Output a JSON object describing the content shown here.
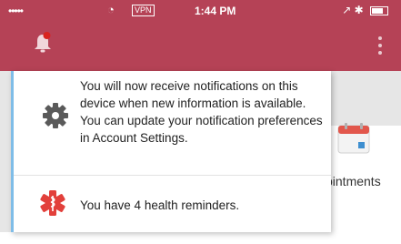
{
  "status_bar": {
    "signal": "•••••",
    "vpn": "VPN",
    "time": "1:44 PM",
    "icons": [
      "wifi-icon",
      "location-icon",
      "bluetooth-icon",
      "battery-icon"
    ]
  },
  "toolbar": {
    "notification_icon": "bell-icon",
    "unread_indicator": true,
    "menu_icon": "kebab-menu-icon"
  },
  "background": {
    "tile_label": "pintments",
    "tile_icon": "calendar-icon"
  },
  "notifications": [
    {
      "icon": "gear-icon",
      "text": "You will now receive notifications on this device when new information is available. You can update your notification preferences in Account Settings."
    },
    {
      "icon": "medical-star-icon",
      "text": "You have 4 health reminders."
    }
  ],
  "colors": {
    "header": "#b54256",
    "unread_dot": "#d9231f",
    "accent_border": "#7fbde8",
    "medical_icon": "#e2403b",
    "calendar_red": "#e2574c",
    "calendar_blue": "#3e8fd0"
  }
}
